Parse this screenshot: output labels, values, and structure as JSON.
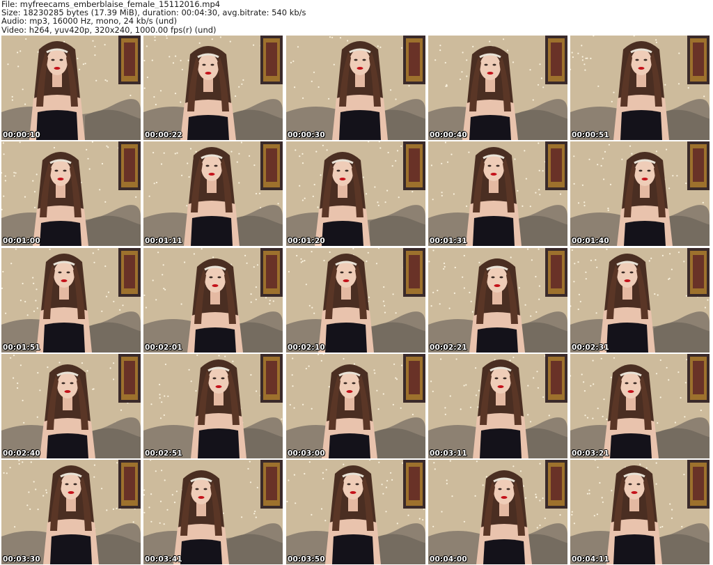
{
  "header": {
    "file_line": "File: myfreecams_emberblaise_female_15112016.mp4",
    "size_line": "Size: 18230285 bytes (17.39 MiB), duration: 00:04:30, avg.bitrate: 540 kb/s",
    "audio_line": "Audio: mp3, 16000 Hz, mono, 24 kb/s (und)",
    "video_line": "Video: h264, yuv420p, 320x240, 1000.00 fps(r) (und)"
  },
  "thumbnails": [
    {
      "timestamp": "00:00:10"
    },
    {
      "timestamp": "00:00:22"
    },
    {
      "timestamp": "00:00:30"
    },
    {
      "timestamp": "00:00:40"
    },
    {
      "timestamp": "00:00:51"
    },
    {
      "timestamp": "00:01:00"
    },
    {
      "timestamp": "00:01:11"
    },
    {
      "timestamp": "00:01:20"
    },
    {
      "timestamp": "00:01:31"
    },
    {
      "timestamp": "00:01:40"
    },
    {
      "timestamp": "00:01:51"
    },
    {
      "timestamp": "00:02:01"
    },
    {
      "timestamp": "00:02:10"
    },
    {
      "timestamp": "00:02:21"
    },
    {
      "timestamp": "00:02:31"
    },
    {
      "timestamp": "00:02:40"
    },
    {
      "timestamp": "00:02:51"
    },
    {
      "timestamp": "00:03:00"
    },
    {
      "timestamp": "00:03:11"
    },
    {
      "timestamp": "00:03:21"
    },
    {
      "timestamp": "00:03:30"
    },
    {
      "timestamp": "00:03:41"
    },
    {
      "timestamp": "00:03:50"
    },
    {
      "timestamp": "00:04:00"
    },
    {
      "timestamp": "00:04:11"
    }
  ]
}
